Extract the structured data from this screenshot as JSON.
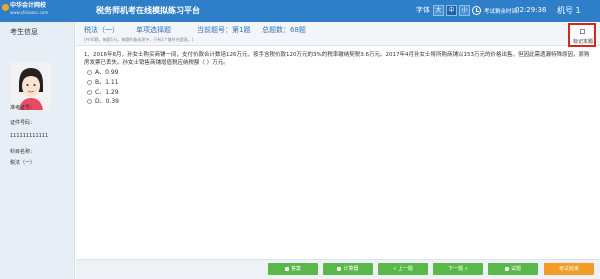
{
  "header": {
    "logo_text": "中华会计网校",
    "logo_url": "www.chinaacc.com",
    "title": "税务师机考在线模拟练习平台",
    "font_label": "字体",
    "font_sizes": [
      "大",
      "中",
      "小"
    ],
    "timer_label": "考试剩余时间：",
    "timer_value": "02:29:36",
    "machine_label": "机号 1"
  },
  "sidebar": {
    "title": "考生信息",
    "ticket_label": "准考证号：",
    "id_label": "证件号码：",
    "id_value": "111111111111",
    "subject_label": "科目名称：",
    "subject_value": "税法（一）"
  },
  "question_header": {
    "subject": "税法（一）",
    "type": "单项选择题",
    "current": "当前题号：第1题",
    "total": "总题数：68题",
    "note": "(共40题，每题1分。每题的备选项中，只有1个最符合题意。)"
  },
  "bookmark": {
    "label": "标记本题"
  },
  "question": {
    "text": "1、2016年8月，孙女士购买商铺一间，支付价款合计数培126万元，按手含税价款120万元的3%的税率缴纳契税3.6万元。2017年4月孙女士将所购商铺以153万元的价格出售。但因此需遗漏特殊原因，原购房发票已丢失。孙女士销售商铺增值税应纳税额（    ）万元。",
    "options": [
      "A、0.99",
      "B、1.11",
      "C、1.29",
      "D、0.39"
    ]
  },
  "footer": {
    "buttons": [
      "答案",
      "计算器",
      "« 上一题",
      "下一题 »",
      "试题",
      "考试结束"
    ]
  },
  "colors": {
    "header_bg": "#2f7fc8",
    "accent_green": "#5ab84a",
    "accent_orange": "#f39b24",
    "bookmark_border": "#d9261c"
  }
}
